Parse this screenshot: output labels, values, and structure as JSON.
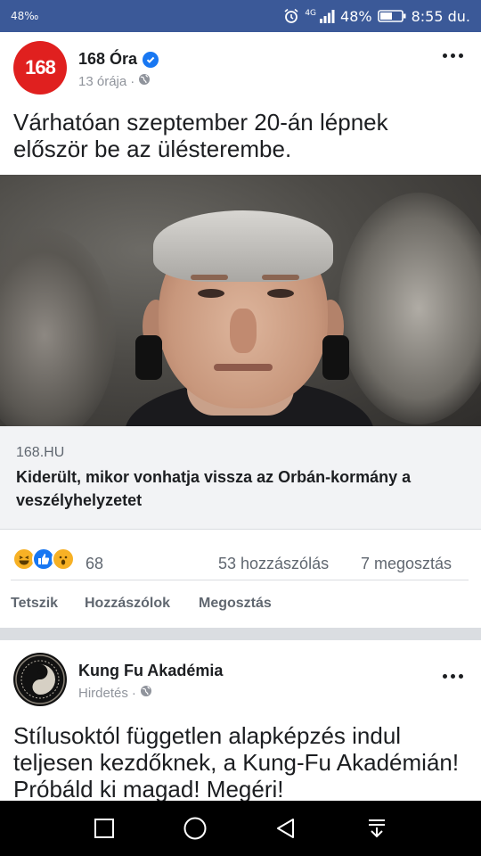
{
  "status_bar": {
    "left_text": "48‰",
    "network": "4G",
    "battery": "48%",
    "time": "8:55 du."
  },
  "post1": {
    "page_name": "168 Óra",
    "avatar_text": "168",
    "time": "13 órája",
    "separator": "·",
    "text": "Várhatóan szeptember 20-án lépnek először be az ülésterembe.",
    "link": {
      "domain": "168.HU",
      "title": "Kiderült, mikor vonhatja vissza az Orbán-kormány a veszélyhelyzetet"
    },
    "reactions_count": "68",
    "comments": "53 hozzászólás",
    "shares": "7 megosztás",
    "actions": {
      "like": "Tetszik",
      "comment": "Hozzászólok",
      "share": "Megosztás"
    }
  },
  "post2": {
    "page_name": "Kung Fu Akadémia",
    "label": "Hirdetés",
    "separator": "·",
    "text": "Stílusoktól független alapképzés indul teljesen kezdőknek, a Kung-Fu Akadémián! Próbáld ki magad! Megéri!"
  },
  "colors": {
    "brand": "#3b5998",
    "avatar_red": "#e0201f",
    "verified": "#1877f2"
  },
  "icons": [
    "alarm-icon",
    "signal-icon",
    "battery-icon",
    "verified-icon",
    "globe-icon",
    "more-icon",
    "haha-icon",
    "like-icon",
    "wow-icon",
    "recent-apps-icon",
    "home-icon",
    "back-icon",
    "notification-pull-icon"
  ]
}
